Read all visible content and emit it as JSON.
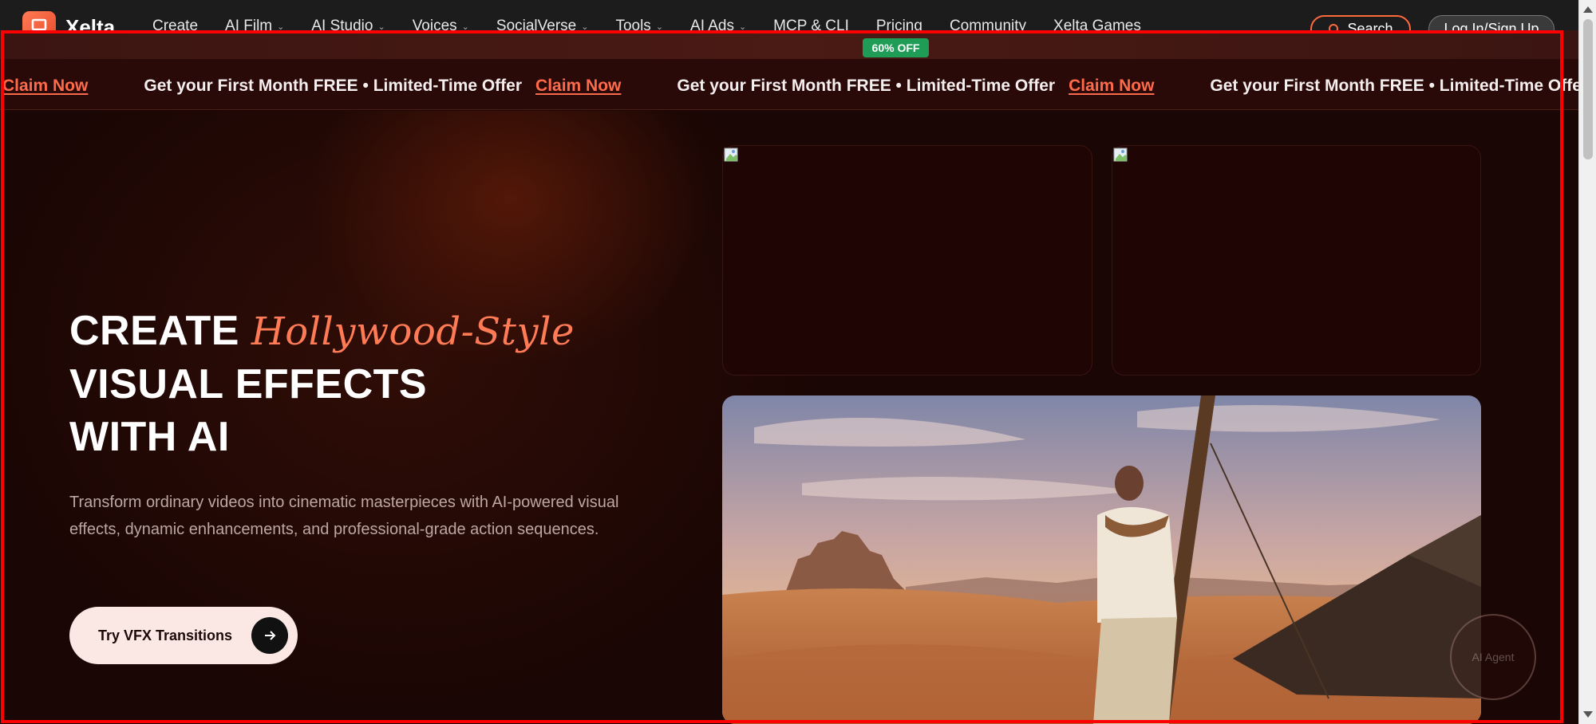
{
  "brand": {
    "name": "Xelta"
  },
  "nav": {
    "items": [
      {
        "label": "Create",
        "dropdown": false
      },
      {
        "label": "AI Film",
        "dropdown": true
      },
      {
        "label": "AI Studio",
        "dropdown": true
      },
      {
        "label": "Voices",
        "dropdown": true
      },
      {
        "label": "SocialVerse",
        "dropdown": true
      },
      {
        "label": "Tools",
        "dropdown": true
      },
      {
        "label": "AI Ads",
        "dropdown": true
      },
      {
        "label": "MCP & CLI",
        "dropdown": false
      },
      {
        "label": "Pricing",
        "dropdown": false
      },
      {
        "label": "Community",
        "dropdown": false
      },
      {
        "label": "Xelta Games",
        "dropdown": false
      }
    ],
    "search_label": "Search",
    "login_label": "Log In/Sign Up"
  },
  "promo": {
    "badge": "60% OFF",
    "offer_text": "Get your First Month FREE • Limited-Time Offer",
    "claim_label": "Claim Now"
  },
  "hero": {
    "headline_lead": "CREATE",
    "headline_accent": "Hollywood-Style",
    "headline_line2": "VISUAL EFFECTS",
    "headline_line3": "WITH AI",
    "subcopy": "Transform ordinary videos into cinematic masterpieces with AI-powered visual effects, dynamic enhancements, and professional-grade action sequences.",
    "cta_label": "Try VFX Transitions"
  },
  "fab": {
    "label": "AI Agent"
  },
  "colors": {
    "accent": "#ff6b4a",
    "badge": "#1f9d57",
    "highlight": "#ff0000",
    "background": "#1a0604"
  }
}
